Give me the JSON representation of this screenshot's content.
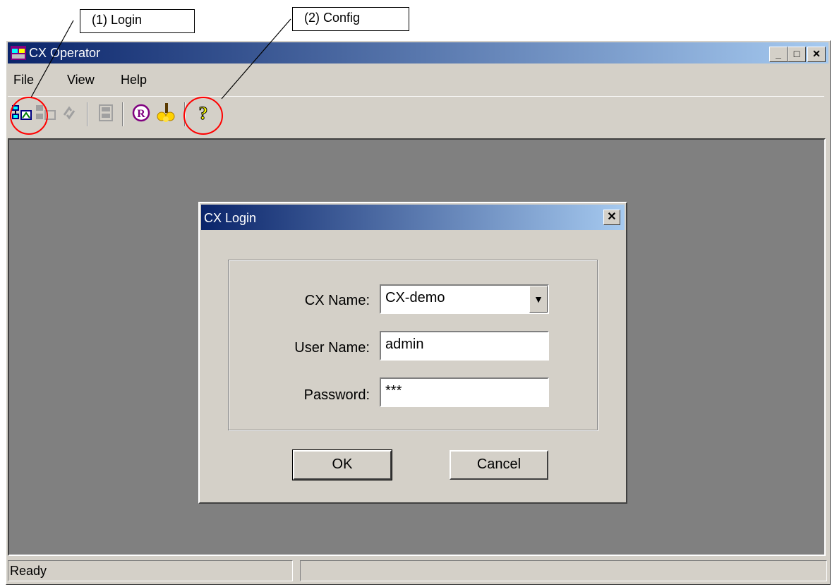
{
  "callouts": {
    "login": "(1) Login",
    "config": "(2) Config"
  },
  "window": {
    "title": "CX Operator"
  },
  "menu": {
    "file": "File",
    "view": "View",
    "help": "Help"
  },
  "toolbar": {
    "icons": [
      "login-icon",
      "logout-icon",
      "refresh-icon",
      "print-icon",
      "register-icon",
      "config-icon",
      "help-icon"
    ]
  },
  "status": {
    "text": "Ready"
  },
  "dialog": {
    "title": "CX Login",
    "cx_name_label": "CX Name:",
    "cx_name_value": "CX-demo",
    "user_name_label": "User Name:",
    "user_name_value": "admin",
    "password_label": "Password:",
    "password_value": "***",
    "ok_label": "OK",
    "cancel_label": "Cancel"
  },
  "colors": {
    "titlebar_start": "#0a246a",
    "titlebar_end": "#a6caf0",
    "callout_circle": "#ff0000"
  }
}
